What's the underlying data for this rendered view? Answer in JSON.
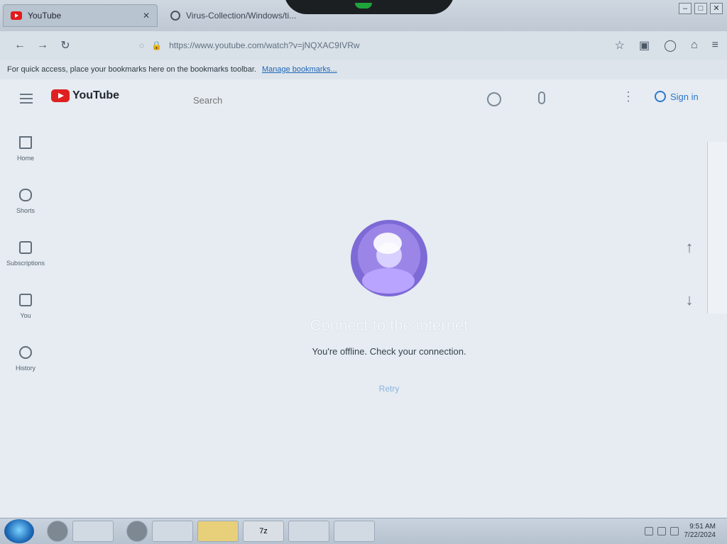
{
  "browser": {
    "tabs": [
      {
        "title": "YouTube",
        "active": true
      },
      {
        "title": "Virus-Collection/Windows/ti...",
        "active": false
      }
    ],
    "url": "https://www.youtube.com/watch?v=jNQXAC9IVRw",
    "bookmark_bar": {
      "message": "For quick access, place your bookmarks here on the bookmarks toolbar.",
      "link": "Manage bookmarks..."
    }
  },
  "youtube": {
    "logo_text": "YouTube",
    "search_placeholder": "Search",
    "sign_in": "Sign in",
    "guide": [
      {
        "label": "Home",
        "icon": "home-icon"
      },
      {
        "label": "Shorts",
        "icon": "shorts-icon"
      },
      {
        "label": "Subscriptions",
        "icon": "subscriptions-icon"
      },
      {
        "label": "You",
        "icon": "you-icon"
      },
      {
        "label": "History",
        "icon": "history-icon"
      }
    ],
    "offline": {
      "title": "Connect to the internet",
      "subtitle": "You're offline. Check your connection.",
      "retry": "Retry"
    }
  },
  "taskbar": {
    "time": "9:51 AM",
    "date": "7/22/2024"
  },
  "colors": {
    "youtube_red": "#e02020",
    "link_blue": "#2d77c9"
  }
}
